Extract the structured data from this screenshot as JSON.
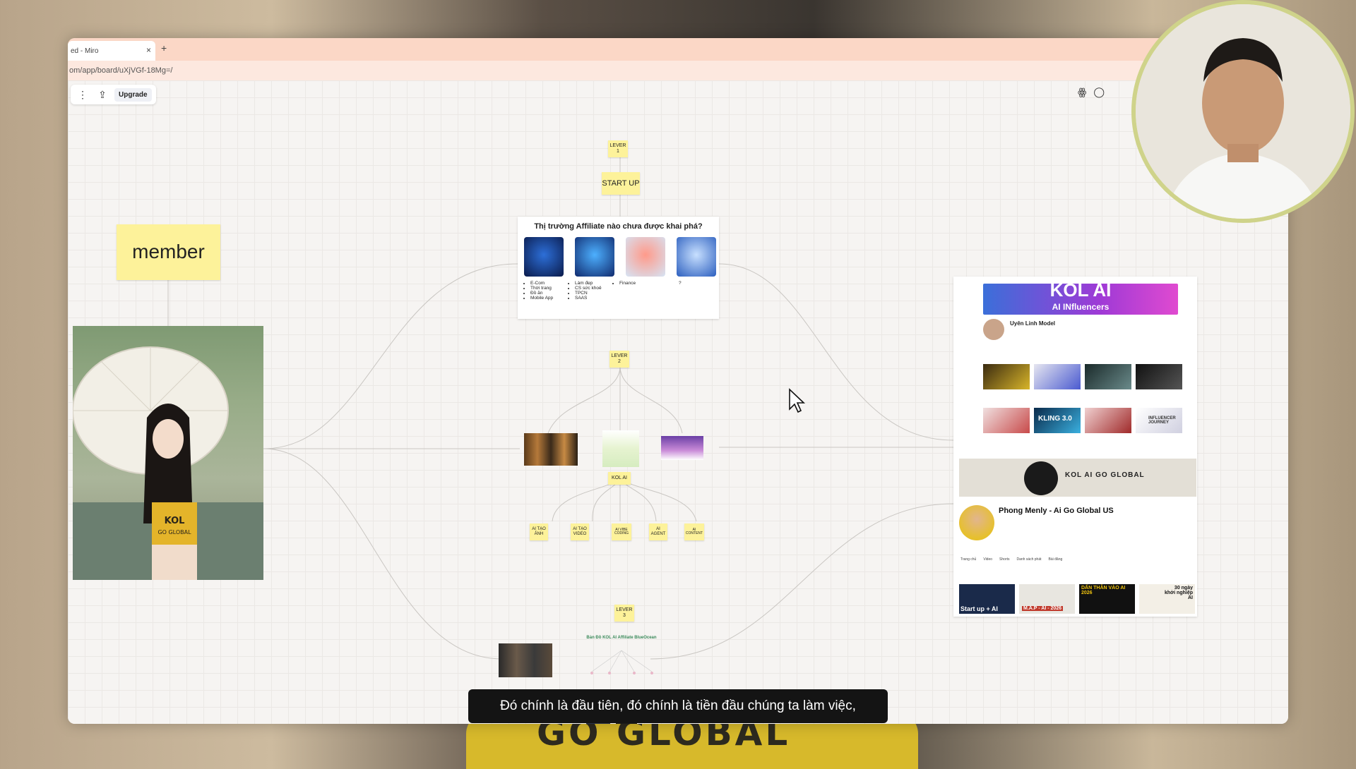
{
  "browser": {
    "tab_title": "ed - Miro",
    "tab_close": "×",
    "tab_new": "+",
    "url": "om/app/board/uXjVGf-18Mg=/"
  },
  "toolbar": {
    "menu_icon": "more-vertical-icon",
    "share_icon": "upload-icon",
    "upgrade_label": "Upgrade",
    "right_icons": [
      "reactions-icon",
      "comment-icon"
    ]
  },
  "board": {
    "member_note": "member",
    "lever1": "LEVER\n1",
    "startup": "START UP",
    "market_card": {
      "title": "Thị trường Affiliate nào chưa được khai phá?",
      "columns": [
        {
          "items": [
            "E-Com",
            "Thời trang",
            "Đồ ăn",
            "Mobile App"
          ]
        },
        {
          "items": [
            "Làm đẹp",
            "CS sức khoẻ",
            "TPCN",
            "SAAS"
          ]
        },
        {
          "items": [
            "Finance"
          ]
        },
        {
          "items": [
            "?"
          ]
        }
      ]
    },
    "lever2": "LEVER\n2",
    "kol_ai": "KOL AI",
    "sub_notes": [
      "AI TẠO\nẢNH",
      "AI TẠO\nVIDEO",
      "AI VIBE\nCODING",
      "AI\nAGENT",
      "AI\nCONTENT"
    ],
    "lever3": "LEVER\n3",
    "map_title": "Bản Đồ KOL AI Affiliate BlueOcean",
    "photo_label": "KOL\nGO GLOBAL"
  },
  "profiles": {
    "banner_title": "KOL AI",
    "banner_sub": "AI INfluencers",
    "channel1_name": "Uyên Linh Model",
    "channel2_banner": "KOL AI GO GLOBAL",
    "channel2_name": "Phong Menly - Ai Go Global US",
    "tabs": [
      "Trang chủ",
      "Video",
      "Shorts",
      "Danh sách phát",
      "Bài đăng"
    ],
    "video_thumbs": [
      "Start up + AI",
      "M.A.P - AI - 2026",
      "DẤN THÂN VÀO AI 2026",
      "30 ngày khởi nghiệp AI"
    ],
    "thumb_badge": "KLING 3.0",
    "thumb_badge2": "INFLUENCER JOURNEY"
  },
  "subtitle": "Đó chính là đầu tiên, đó chính là tiền đầu chúng ta làm việc,"
}
